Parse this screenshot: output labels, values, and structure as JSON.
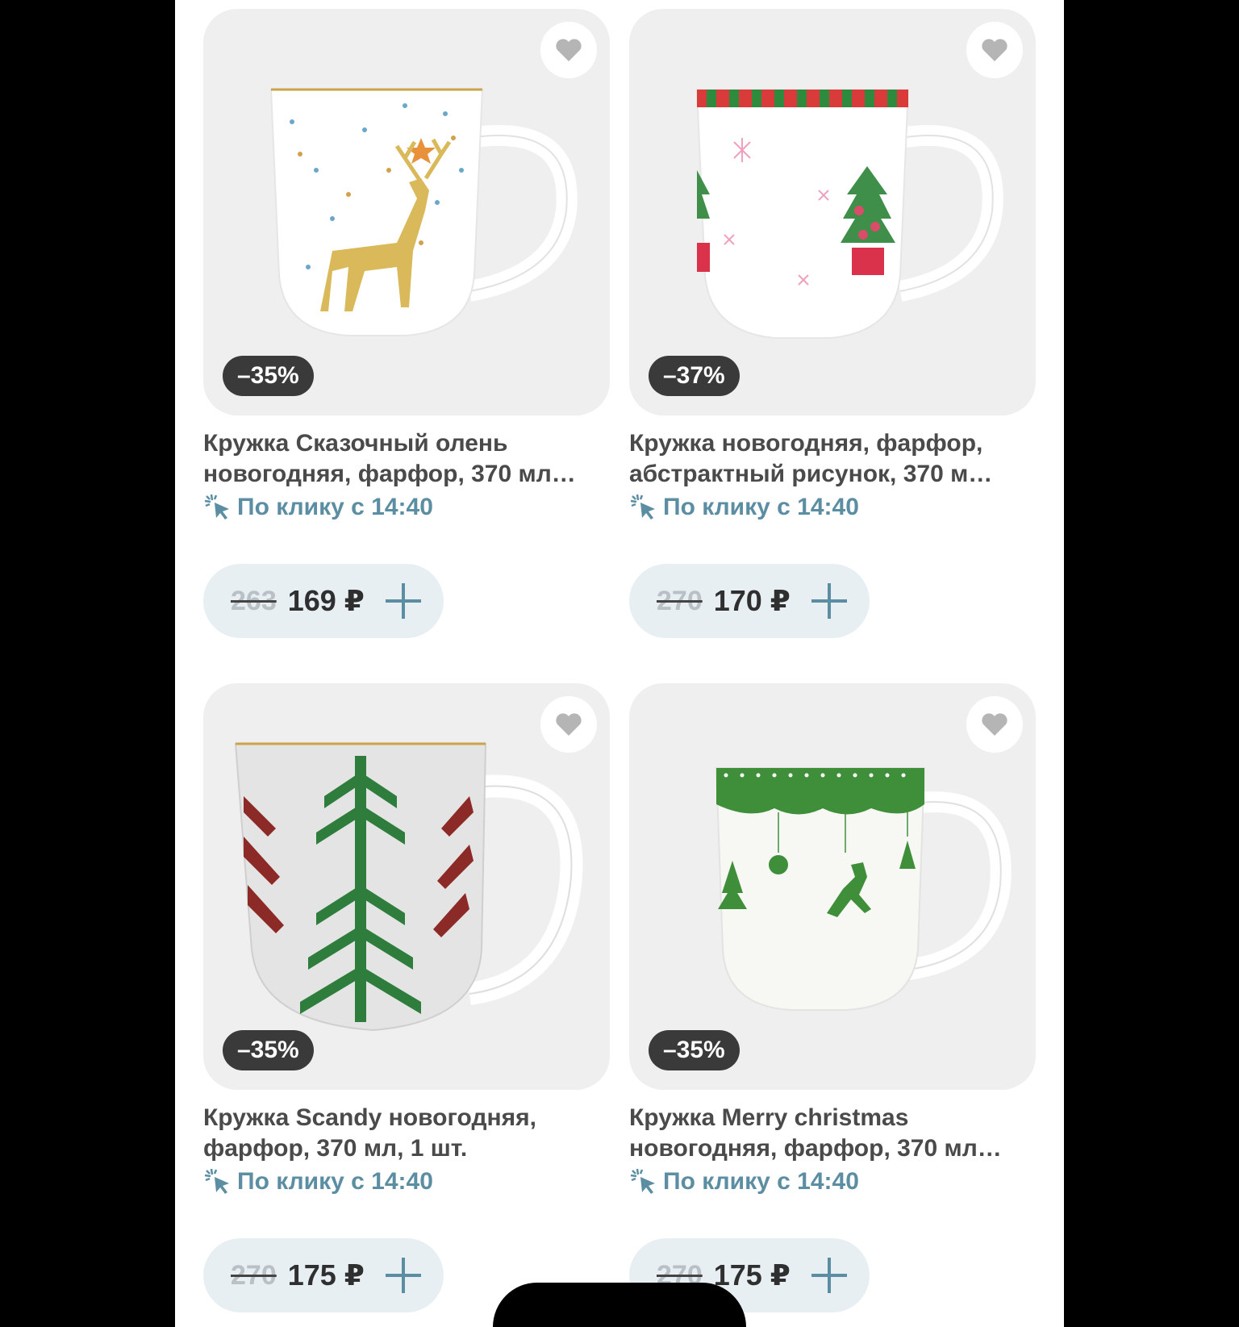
{
  "products": [
    {
      "title": "Кружка Сказочный олень\nновогодняя, фарфор, 370 мл…",
      "discount": "–35%",
      "delivery": "По клику с 14:40",
      "old_price": "263",
      "new_price": "169 ₽",
      "design": "deer"
    },
    {
      "title": "Кружка новогодняя, фарфор,\nабстрактный рисунок, 370 м…",
      "discount": "–37%",
      "delivery": "По клику с 14:40",
      "old_price": "270",
      "new_price": "170 ₽",
      "design": "trees"
    },
    {
      "title": "Кружка Scandy новогодняя,\nфарфор, 370 мл, 1 шт.",
      "discount": "–35%",
      "delivery": "По клику с 14:40",
      "old_price": "270",
      "new_price": "175 ₽",
      "design": "knit"
    },
    {
      "title": "Кружка Merry christmas\nновогодняя, фарфор, 370 мл…",
      "discount": "–35%",
      "delivery": "По клику с 14:40",
      "old_price": "270",
      "new_price": "175 ₽",
      "design": "merry"
    }
  ],
  "colors": {
    "accent": "#5c8ea3",
    "badge_bg": "#3a3a3a",
    "price_pill_bg": "#e8eff3",
    "card_bg": "#efefef"
  },
  "icons": {
    "favorite": "heart-icon",
    "add": "plus-icon",
    "delivery": "click-sparkle-icon"
  }
}
